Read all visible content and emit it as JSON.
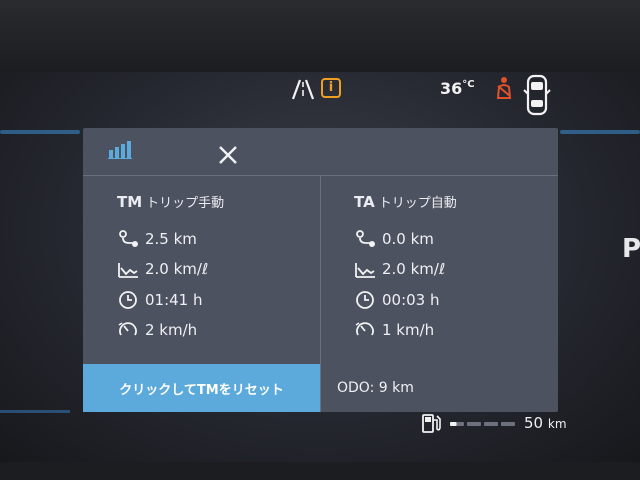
{
  "status": {
    "temperature": "36",
    "temperature_unit": "°C",
    "info_icon_text": "i",
    "colors": {
      "warning": "#f0a020",
      "seatbelt": "#e0502a"
    }
  },
  "panel": {
    "header": {
      "stats_icon": "bar-chart-icon",
      "close_icon": "close-icon"
    },
    "trip_manual": {
      "code": "TM",
      "title": "トリップ手動",
      "distance": "2.5 km",
      "consumption": "2.0 km/ℓ",
      "time": "01:41 h",
      "avg_speed": "2 km/h"
    },
    "trip_auto": {
      "code": "TA",
      "title": "トリップ自動",
      "distance": "0.0 km",
      "consumption": "2.0 km/ℓ",
      "time": "00:03 h",
      "avg_speed": "1 km/h"
    },
    "reset_label": "クリックしてTMをリセット",
    "odo": "ODO: 9 km",
    "reset_color": "#5ca9dc"
  },
  "footer": {
    "range_value": "50",
    "range_unit": "km",
    "fuel_level": 0.1
  },
  "edge_text": "P"
}
